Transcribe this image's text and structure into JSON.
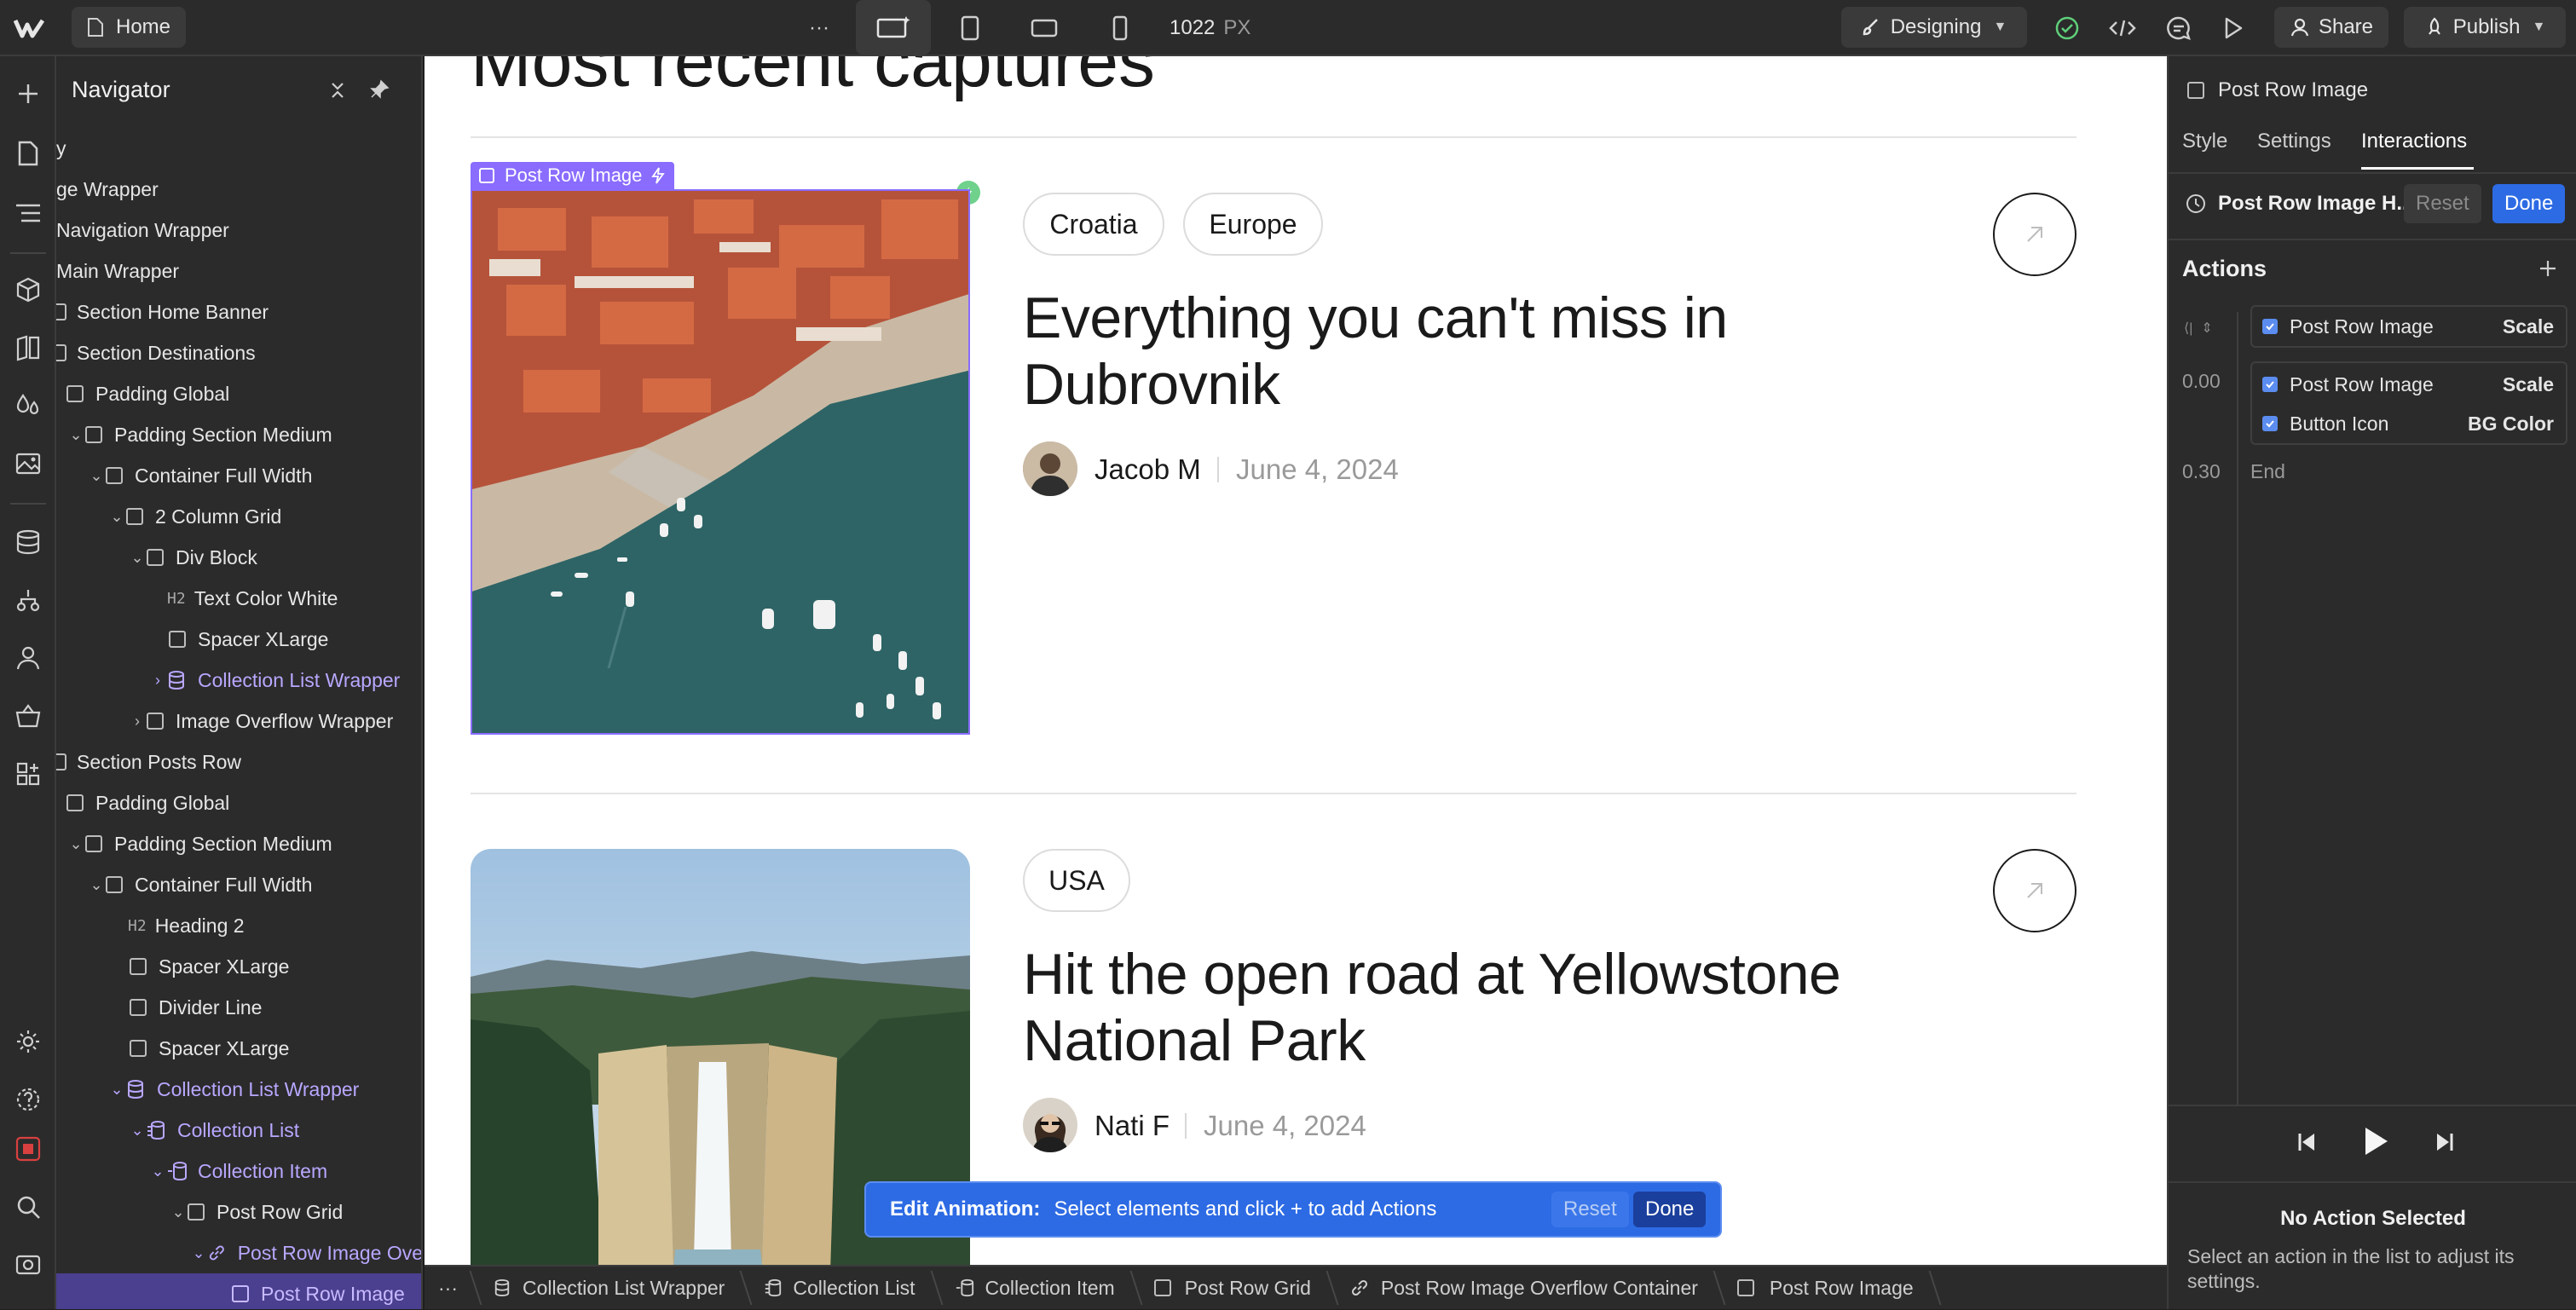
{
  "topbar": {
    "page_name": "Home",
    "more_label": "···",
    "width_value": "1022",
    "width_unit": "PX",
    "mode_label": "Designing",
    "share_label": "Share",
    "publish_label": "Publish"
  },
  "navigator": {
    "title": "Navigator",
    "items": [
      {
        "label": "y"
      },
      {
        "label": "ge Wrapper"
      },
      {
        "label": "Navigation Wrapper"
      },
      {
        "label": "Main Wrapper"
      },
      {
        "label": "Section Home Banner"
      },
      {
        "label": "Section Destinations"
      },
      {
        "label": "Padding Global"
      },
      {
        "label": "Padding Section Medium"
      },
      {
        "label": "Container Full Width"
      },
      {
        "label": "2 Column Grid"
      },
      {
        "label": "Div Block"
      },
      {
        "label": "Text Color White",
        "badge": "H2"
      },
      {
        "label": "Spacer XLarge"
      },
      {
        "label": "Collection List Wrapper"
      },
      {
        "label": "Image Overflow Wrapper"
      },
      {
        "label": "Section Posts Row"
      },
      {
        "label": "Padding Global"
      },
      {
        "label": "Padding Section Medium"
      },
      {
        "label": "Container Full Width"
      },
      {
        "label": "Heading 2",
        "badge": "H2"
      },
      {
        "label": "Spacer XLarge"
      },
      {
        "label": "Divider Line"
      },
      {
        "label": "Spacer XLarge"
      },
      {
        "label": "Collection List Wrapper"
      },
      {
        "label": "Collection List"
      },
      {
        "label": "Collection Item"
      },
      {
        "label": "Post Row Grid"
      },
      {
        "label": "Post Row Image Ove"
      },
      {
        "label": "Post Row Image"
      }
    ]
  },
  "canvas": {
    "heading_partial": "Most recent captures",
    "selected_label": "Post Row Image",
    "posts": [
      {
        "tags": [
          "Croatia",
          "Europe"
        ],
        "title": "Everything you can't miss in Dubrovnik",
        "author": "Jacob M",
        "date": "June 4, 2024"
      },
      {
        "tags": [
          "USA"
        ],
        "title": "Hit the open road at Yellowstone National Park",
        "author": "Nati F",
        "date": "June 4, 2024"
      }
    ]
  },
  "edit_animation": {
    "label": "Edit Animation:",
    "message": "Select elements and click + to add Actions",
    "reset": "Reset",
    "done": "Done"
  },
  "breadcrumbs": [
    "Collection List Wrapper",
    "Collection List",
    "Collection Item",
    "Post Row Grid",
    "Post Row Image Overflow Container",
    "Post Row Image"
  ],
  "breadcrumb_more": "···",
  "right_panel": {
    "element_name": "Post Row Image",
    "tabs": [
      "Style",
      "Settings",
      "Interactions"
    ],
    "active_tab": "Interactions",
    "trigger_name": "Post Row Image H...",
    "reset": "Reset",
    "done": "Done",
    "actions_title": "Actions",
    "actions": [
      {
        "time": "",
        "target": "Post Row Image",
        "type": "Scale"
      },
      {
        "time": "0.00",
        "target": "Post Row Image",
        "type": "Scale"
      },
      {
        "time": "",
        "target": "Button Icon",
        "type": "BG Color"
      }
    ],
    "end_time": "0.30",
    "end_label": "End",
    "no_action_title": "No Action Selected",
    "no_action_desc": "Select an action in the list to adjust its settings."
  },
  "colors": {
    "accent": "#5b8cf0",
    "selection": "#8a6cff",
    "publish_blue": "#2d6be4"
  }
}
